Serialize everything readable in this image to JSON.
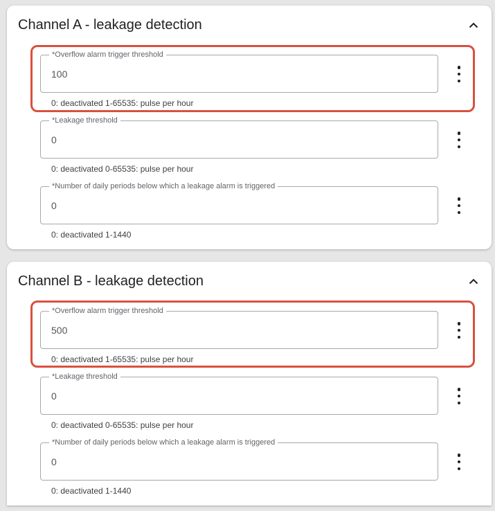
{
  "channel_a": {
    "title": "Channel A - leakage detection",
    "fields": [
      {
        "label": "*Overflow alarm trigger threshold",
        "value": "100",
        "hint": "0: deactivated 1-65535: pulse per hour",
        "highlighted": true
      },
      {
        "label": "*Leakage threshold",
        "value": "0",
        "hint": "0: deactivated 0-65535: pulse per hour",
        "highlighted": false
      },
      {
        "label": "*Number of daily periods below which a leakage alarm is triggered",
        "value": "0",
        "hint": "0: deactivated 1-1440",
        "highlighted": false
      }
    ]
  },
  "channel_b": {
    "title": "Channel B - leakage detection",
    "fields": [
      {
        "label": "*Overflow alarm trigger threshold",
        "value": "500",
        "hint": "0: deactivated 1-65535: pulse per hour",
        "highlighted": true
      },
      {
        "label": "*Leakage threshold",
        "value": "0",
        "hint": "0: deactivated 0-65535: pulse per hour",
        "highlighted": false
      },
      {
        "label": "*Number of daily periods below which a leakage alarm is triggered",
        "value": "0",
        "hint": "0: deactivated 1-1440",
        "highlighted": false
      }
    ]
  },
  "icons": {
    "collapse": "chevron-up-icon",
    "more": "more-vert-icon"
  },
  "colors": {
    "highlight": "#d9503f",
    "card": "#ffffff",
    "background": "#e6e6e6"
  }
}
